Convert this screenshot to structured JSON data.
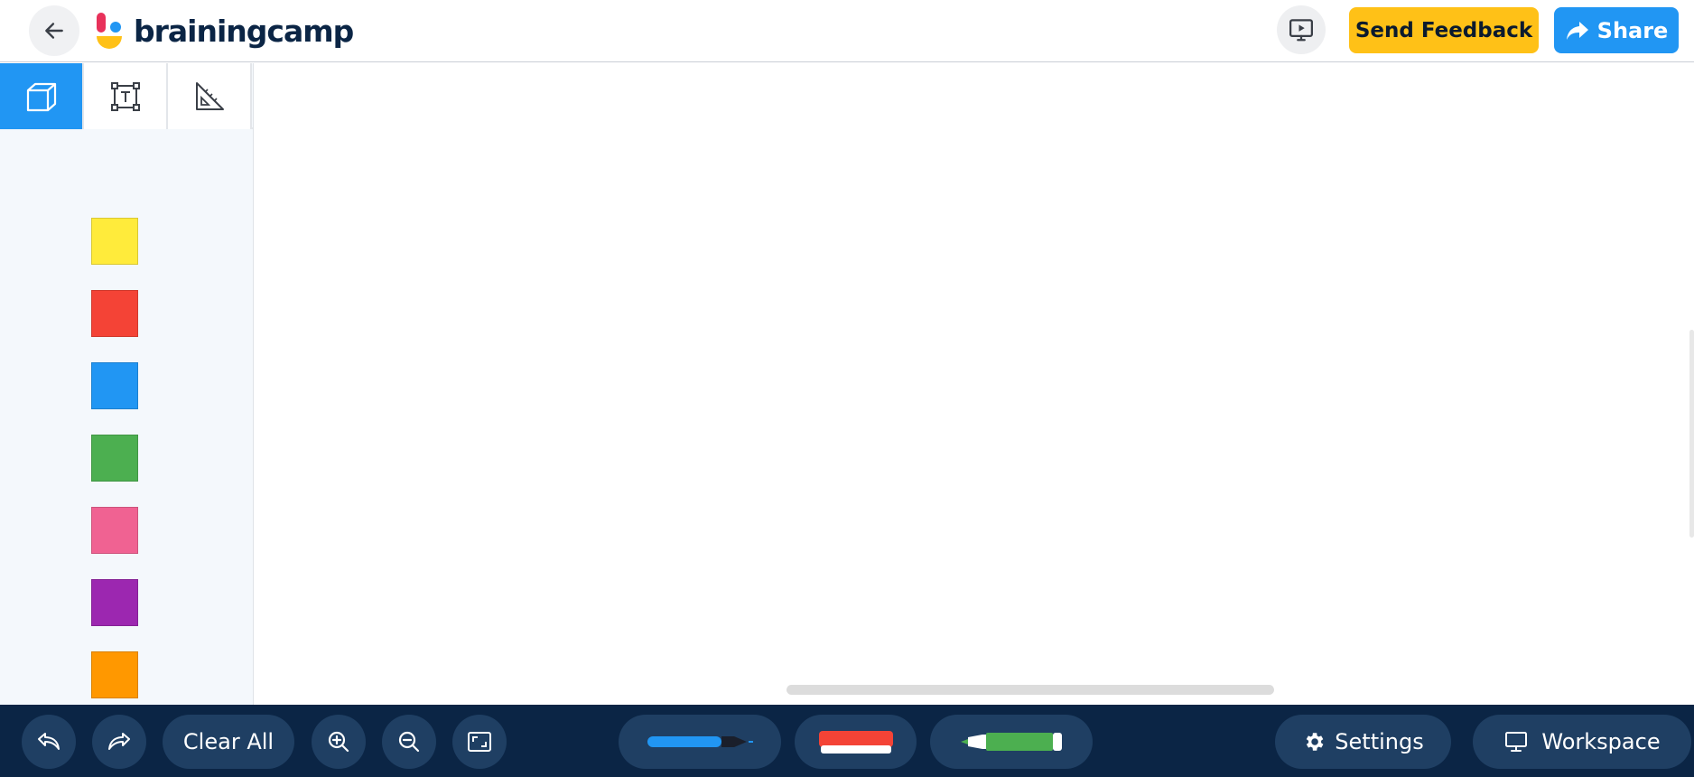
{
  "header": {
    "logo_text": "brainingcamp",
    "feedback_label": "Send Feedback",
    "share_label": "Share"
  },
  "side_panel": {
    "tabs": [
      {
        "name": "cubes",
        "icon": "cube-icon",
        "active": true
      },
      {
        "name": "text-box",
        "icon": "text-box-icon",
        "active": false
      },
      {
        "name": "measure",
        "icon": "ruler-triangle-icon",
        "active": false
      }
    ],
    "swatches": [
      {
        "color_name": "yellow",
        "color": "#ffeb3b"
      },
      {
        "color_name": "red",
        "color": "#f44336"
      },
      {
        "color_name": "blue",
        "color": "#2196f3"
      },
      {
        "color_name": "green",
        "color": "#4caf50"
      },
      {
        "color_name": "pink",
        "color": "#f06292"
      },
      {
        "color_name": "purple",
        "color": "#9c27b0"
      },
      {
        "color_name": "orange",
        "color": "#ff9800"
      }
    ]
  },
  "toolbar": {
    "clear_all_label": "Clear All",
    "settings_label": "Settings",
    "workspace_label": "Workspace",
    "tools": [
      "undo-icon",
      "redo-icon",
      "zoom-in-icon",
      "zoom-out-icon",
      "fit-screen-icon",
      "blue-pen-icon",
      "eraser-icon",
      "green-marker-icon",
      "gear-icon",
      "monitor-icon"
    ]
  },
  "colors": {
    "accent": "#2196f3",
    "feedback": "#ffc117",
    "toolbar_bg": "#0b2545",
    "toolbar_btn": "#1f3f63"
  }
}
